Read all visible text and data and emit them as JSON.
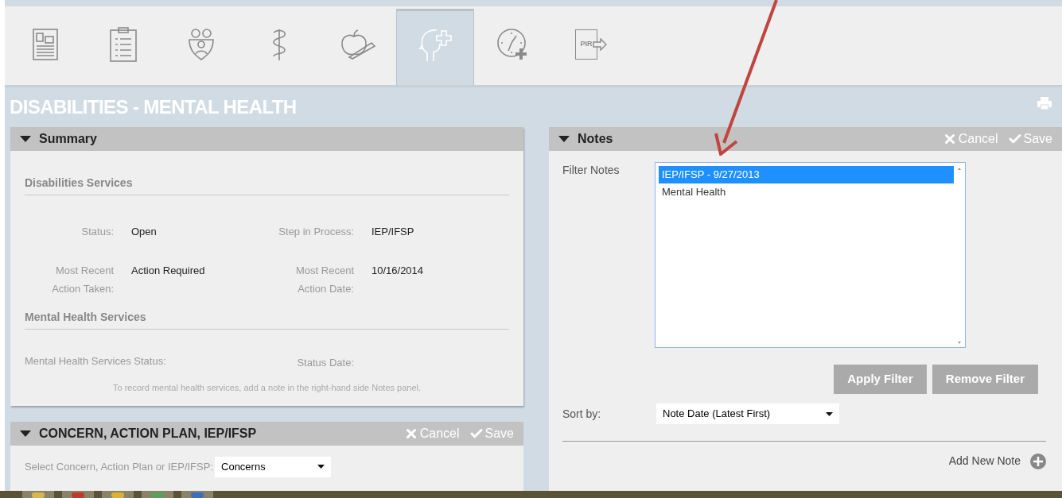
{
  "tabs": [
    {
      "kind": "profile",
      "selected": false
    },
    {
      "kind": "clipboard",
      "selected": false
    },
    {
      "kind": "family",
      "selected": false
    },
    {
      "kind": "caduceus",
      "selected": false
    },
    {
      "kind": "apple",
      "selected": false
    },
    {
      "kind": "head",
      "selected": true
    },
    {
      "kind": "clock",
      "selected": false
    },
    {
      "kind": "pir",
      "selected": false,
      "text": "PIR"
    }
  ],
  "page_title": "DISABILITIES - MENTAL HEALTH",
  "summary": {
    "title": "Summary",
    "expanded": true,
    "sections": [
      {
        "heading": "Disabilities Services",
        "rows": [
          [
            {
              "kind": "field",
              "label": "Status:",
              "value": "Open"
            },
            {
              "kind": "field",
              "label": "Step in Process:",
              "value": "IEP/IFSP"
            }
          ],
          [
            {
              "kind": "field",
              "label": "Most Recent\nAction Taken:",
              "value": "Action Required"
            },
            {
              "kind": "field",
              "label": "Most Recent\nAction Date:",
              "value": "10/16/2014"
            }
          ]
        ]
      },
      {
        "heading": "Mental Health Services",
        "rows": [
          [
            {
              "kind": "wide",
              "label": "Mental Health Services Status:"
            },
            {
              "kind": "field",
              "label": "Status Date:"
            }
          ]
        ],
        "note": "To record mental health services, add a note in the right-hand side Notes panel."
      }
    ]
  },
  "concern": {
    "title": "CONCERN, ACTION PLAN, IEP/IFSP",
    "expanded": true,
    "actions": [
      {
        "kind": "cancel",
        "label": "Cancel"
      },
      {
        "kind": "save",
        "label": "Save"
      }
    ],
    "select_label": "Select Concern, Action Plan or IEP/IFSP:",
    "select_value": "Concerns"
  },
  "notes": {
    "title": "Notes",
    "expanded": true,
    "actions": [
      {
        "kind": "cancel",
        "label": "Cancel"
      },
      {
        "kind": "save",
        "label": "Save"
      }
    ],
    "filter_label": "Filter Notes",
    "options": [
      {
        "label": "IEP/IFSP - 9/27/2013",
        "selected": true
      },
      {
        "label": "Mental Health",
        "selected": false
      }
    ],
    "buttons": [
      "Apply Filter",
      "Remove Filter"
    ],
    "sort_label": "Sort by:",
    "sort_value": "Note Date (Latest First)",
    "add_label": "Add New Note"
  }
}
